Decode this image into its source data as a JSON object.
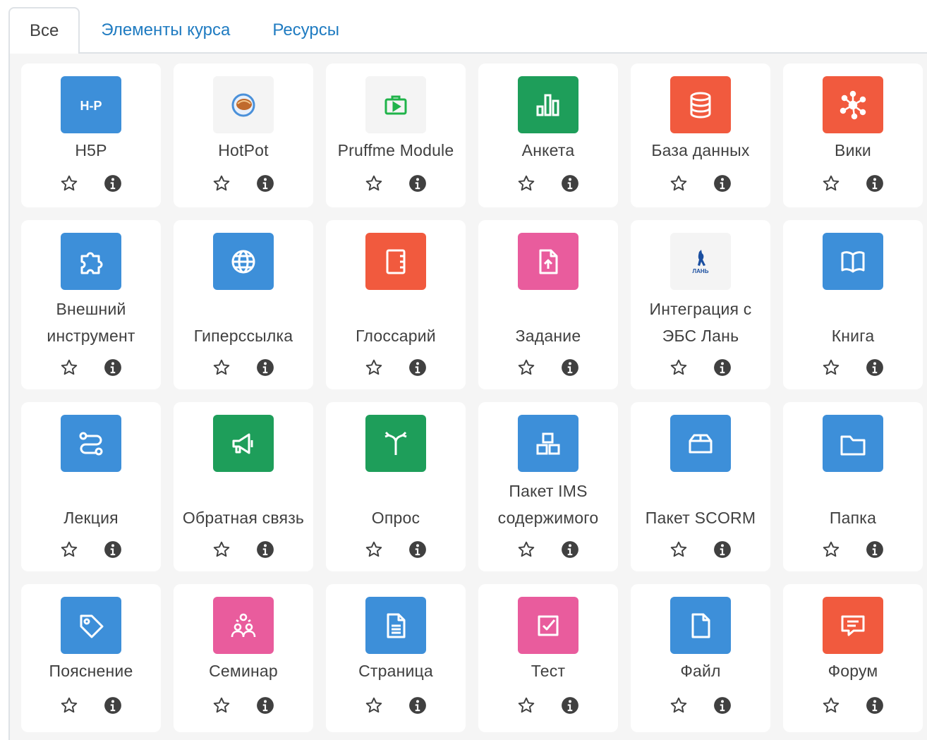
{
  "tabs": [
    {
      "label": "Все",
      "active": true
    },
    {
      "label": "Элементы курса",
      "active": false
    },
    {
      "label": "Ресурсы",
      "active": false
    }
  ],
  "colors": {
    "blue": "#3d8fd9",
    "red": "#f15a3e",
    "green": "#1e9e5a",
    "pink": "#e95c9d",
    "light": "#f4f4f4"
  },
  "items": [
    {
      "label": "H5P",
      "icon": "h5p-icon",
      "color": "blue"
    },
    {
      "label": "HotPot",
      "icon": "hotpot-icon",
      "color": "light"
    },
    {
      "label": "Pruffme Module",
      "icon": "pruffme-icon",
      "color": "light"
    },
    {
      "label": "Анкета",
      "icon": "bar-chart-icon",
      "color": "green"
    },
    {
      "label": "База данных",
      "icon": "database-icon",
      "color": "red"
    },
    {
      "label": "Вики",
      "icon": "network-icon",
      "color": "red"
    },
    {
      "label": "Внешний инструмент",
      "icon": "puzzle-icon",
      "color": "blue"
    },
    {
      "label": "Гиперссылка",
      "icon": "globe-icon",
      "color": "blue"
    },
    {
      "label": "Глоссарий",
      "icon": "notebook-icon",
      "color": "red"
    },
    {
      "label": "Задание",
      "icon": "file-upload-icon",
      "color": "pink"
    },
    {
      "label": "Интеграция с ЭБС Лань",
      "icon": "lan-logo-icon",
      "color": "light"
    },
    {
      "label": "Книга",
      "icon": "book-icon",
      "color": "blue"
    },
    {
      "label": "Лекция",
      "icon": "route-icon",
      "color": "blue"
    },
    {
      "label": "Обратная связь",
      "icon": "megaphone-icon",
      "color": "green"
    },
    {
      "label": "Опрос",
      "icon": "signpost-icon",
      "color": "green"
    },
    {
      "label": "Пакет IMS содержимого",
      "icon": "boxes-icon",
      "color": "blue"
    },
    {
      "label": "Пакет SCORM",
      "icon": "package-icon",
      "color": "blue"
    },
    {
      "label": "Папка",
      "icon": "folder-icon",
      "color": "blue"
    },
    {
      "label": "Пояснение",
      "icon": "tag-icon",
      "color": "blue"
    },
    {
      "label": "Семинар",
      "icon": "people-icon",
      "color": "pink"
    },
    {
      "label": "Страница",
      "icon": "document-icon",
      "color": "blue"
    },
    {
      "label": "Тест",
      "icon": "checkbox-icon",
      "color": "pink"
    },
    {
      "label": "Файл",
      "icon": "file-icon",
      "color": "blue"
    },
    {
      "label": "Форум",
      "icon": "chat-icon",
      "color": "red"
    }
  ],
  "action_icons": {
    "star": "star-icon",
    "info": "info-icon"
  }
}
